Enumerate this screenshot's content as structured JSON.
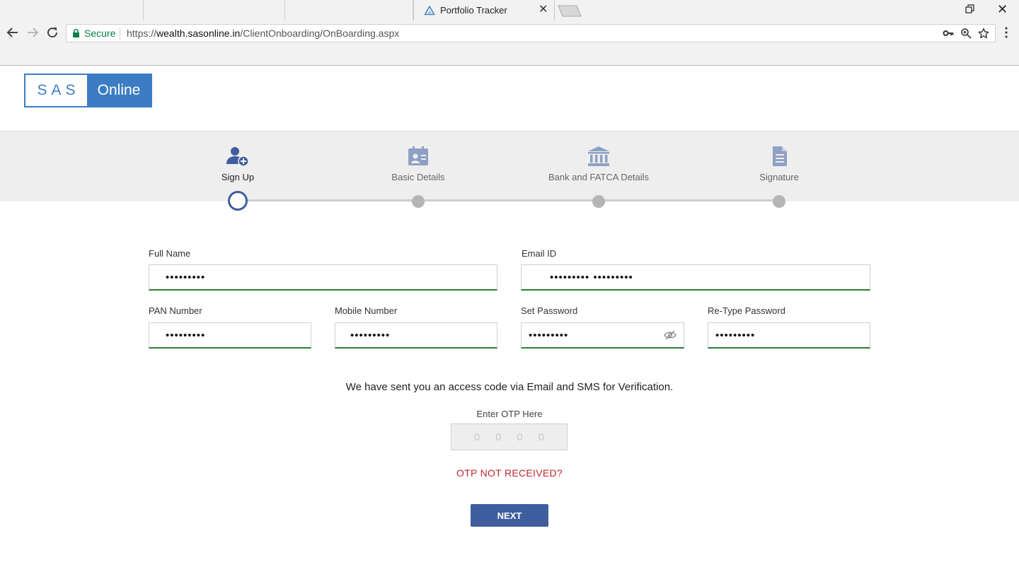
{
  "browser": {
    "tab_title": "Portfolio Tracker",
    "secure_label": "Secure",
    "url_scheme": "https://",
    "url_host": "wealth.sasonline.in",
    "url_path": "/ClientOnboarding/OnBoarding.aspx",
    "icons": [
      "back-arrow-icon",
      "forward-arrow-icon",
      "reload-icon",
      "lock-icon",
      "key-icon",
      "zoom-icon",
      "star-icon",
      "kebab-menu-icon"
    ]
  },
  "logo": {
    "left": "SAS",
    "right": "Online"
  },
  "steps": [
    {
      "label": "Sign Up",
      "icon": "add-user-icon",
      "state": "current"
    },
    {
      "label": "Basic Details",
      "icon": "id-card-icon",
      "state": "pending"
    },
    {
      "label": "Bank and FATCA Details",
      "icon": "bank-icon",
      "state": "pending"
    },
    {
      "label": "Signature",
      "icon": "document-icon",
      "state": "pending"
    }
  ],
  "form": {
    "full_name": {
      "label": "Full Name",
      "value": "•••••••••"
    },
    "email": {
      "label": "Email ID",
      "value": "••••••••• •••••••••"
    },
    "pan": {
      "label": "PAN Number",
      "value": "•••••••••"
    },
    "mobile": {
      "label": "Mobile Number",
      "value": "•••••••••"
    },
    "password": {
      "label": "Set Password",
      "value": "•••••••••"
    },
    "retype_password": {
      "label": "Re-Type Password",
      "value": "•••••••••"
    }
  },
  "otp": {
    "message": "We have sent you an access code via Email and SMS for Verification.",
    "label": "Enter OTP Here",
    "placeholder": "0000",
    "resend_label": "OTP NOT RECEIVED?"
  },
  "next_label": "NEXT",
  "colors": {
    "brand_blue": "#3b7cc4",
    "primary_button": "#3f5e9e",
    "valid_underline": "#2e7d32",
    "error_red": "#c0262c",
    "secure_green": "#0b8043"
  }
}
